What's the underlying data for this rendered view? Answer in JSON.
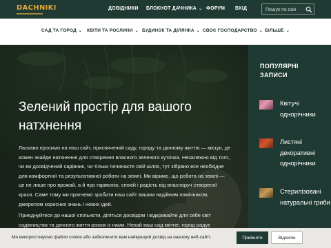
{
  "logo": {
    "text": "DACHNIKI"
  },
  "topnav": {
    "items": [
      {
        "label": "ДОВІДНИКИ"
      },
      {
        "label": "БЛОКНОТ ДАЧНИКА",
        "dropdown": "⌄"
      },
      {
        "label": "ФОРУМ"
      },
      {
        "label": "ВХІД"
      }
    ],
    "search": {
      "placeholder": "Пошук по сай",
      "icon": "search-icon"
    }
  },
  "secnav": {
    "items": [
      {
        "label": "САД ТА ГОРОД",
        "dropdown": "⌄"
      },
      {
        "label": "КВІТИ ТА РОСЛИНИ",
        "dropdown": "⌄"
      },
      {
        "label": "БУДИНОК ТА ДІЛЯНКА",
        "dropdown": "⌄"
      },
      {
        "label": "СВОЄ ГОСПОДАРСТВО",
        "dropdown": "⌄"
      },
      {
        "label": "БІЛЬШЕ",
        "dropdown": "⌄"
      }
    ]
  },
  "hero": {
    "title": "Зелений простір для вашого натхнення",
    "paragraph1": "Ласкаво просимо на наш сайт, присвячений саду, городу та дачному життю — місцю, де кожен знайде натхнення для створення власного зеленого куточка. Незалежно від того, чи ви досвідчений садівник, чи тільки починаєте свій шлях, тут зібрано все необхідне для комфортної та результативної роботи на землі. Ми віримо, що робота на землі — це не лише про врожай, а й про гармонію, спокій і радість від власноруч створеної краси. Саме тому ми прагнемо зробити наш сайт вашим надійним помічником, джерелом корисних знань і нових ідей.",
    "paragraph2": "Приєднуйтеся до нашої спільноти, діліться досвідом і відкривайте для себе світ садівництва та дачного життя разом із нами. Нехай ваш сад квітне, город радує"
  },
  "sidebar": {
    "title": "ПОПУЛЯРНІ ЗАПИСИ",
    "posts": [
      {
        "label": "Квітучі однорічники"
      },
      {
        "label": "Листяні декоративні однорічники"
      },
      {
        "label": "Стерилізовані натуральні гриби"
      }
    ]
  },
  "cookie": {
    "text": "Ми використовуємо файли cookie або забезпечити вам найкращий досвід на нашому веб-сайті.",
    "accept": "Прийняти",
    "reject": "Відхилю"
  },
  "colors": {
    "brand_dark": "#1f3a33",
    "logo_accent": "#e2a93b"
  }
}
